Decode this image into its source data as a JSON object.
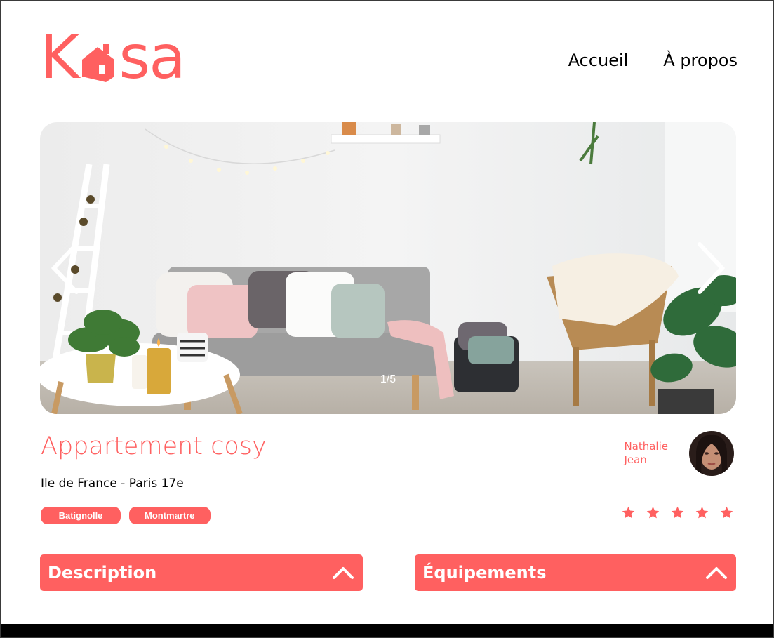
{
  "brand": {
    "logo_left": "K",
    "logo_right": "sa",
    "accent": "#FF6060"
  },
  "nav": {
    "items": [
      {
        "label": "Accueil"
      },
      {
        "label": "À propos"
      }
    ]
  },
  "gallery": {
    "counter": "1/5"
  },
  "listing": {
    "title": "Appartement cosy",
    "location": "Ile de France - Paris 17e",
    "tags": [
      "Batignolle",
      "Montmartre"
    ],
    "host": {
      "first_name": "Nathalie",
      "last_name": "Jean"
    },
    "rating": 5,
    "rating_max": 5
  },
  "sections": [
    {
      "title": "Description",
      "icon": "chevron-up-icon"
    },
    {
      "title": "Équipements",
      "icon": "chevron-up-icon"
    }
  ]
}
